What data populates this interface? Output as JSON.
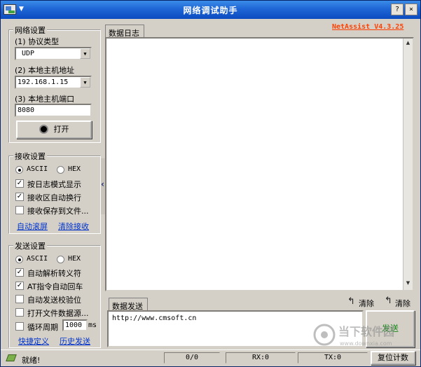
{
  "window": {
    "title": "网络调试助手"
  },
  "titlebar_buttons": {
    "help": "?",
    "close": "×"
  },
  "version": "NetAssist V4.3.25",
  "network": {
    "legend": "网络设置",
    "protocol_label": "(1) 协议类型",
    "protocol_value": "UDP",
    "host_label": "(2) 本地主机地址",
    "host_value": "192.168.1.15",
    "port_label": "(3) 本地主机端口",
    "port_value": "8080",
    "open_button": "打开"
  },
  "receive": {
    "legend": "接收设置",
    "ascii": "ASCII",
    "hex": "HEX",
    "encoding_selected": "ASCII",
    "options": [
      {
        "label": "按日志模式显示",
        "checked": true
      },
      {
        "label": "接收区自动换行",
        "checked": true
      },
      {
        "label": "接收保存到文件...",
        "checked": false
      }
    ],
    "link_autoscroll": "自动滚屏",
    "link_clear": "清除接收"
  },
  "send": {
    "legend": "发送设置",
    "ascii": "ASCII",
    "hex": "HEX",
    "encoding_selected": "ASCII",
    "options": [
      {
        "label": "自动解析转义符",
        "checked": true
      },
      {
        "label": "AT指令自动回车",
        "checked": true
      },
      {
        "label": "自动发送校验位",
        "checked": false
      },
      {
        "label": "打开文件数据源...",
        "checked": false
      }
    ],
    "cycle_label": "循环周期",
    "cycle_value": "1000",
    "cycle_unit": "ms",
    "cycle_checked": false,
    "link_shortcut": "快捷定义",
    "link_history": "历史发送"
  },
  "log": {
    "tab": "数据日志",
    "collapse_glyph": "‹"
  },
  "sendarea": {
    "tab": "数据发送",
    "clear1": "清除",
    "clear2": "清除",
    "content": "http://www.cmsoft.cn",
    "send_button": "发送"
  },
  "status": {
    "text": "就绪!",
    "counter": "0/0",
    "rx": "RX:0",
    "tx": "TX:0",
    "reset_button": "复位计数"
  },
  "watermark": {
    "text_main": "当下软件园",
    "text_sub": "www.downxia.com"
  },
  "colors": {
    "titlebar": "#1f66d6",
    "version": "#ff4000",
    "link": "#0033cc",
    "send_text": "#1a8a1a"
  }
}
